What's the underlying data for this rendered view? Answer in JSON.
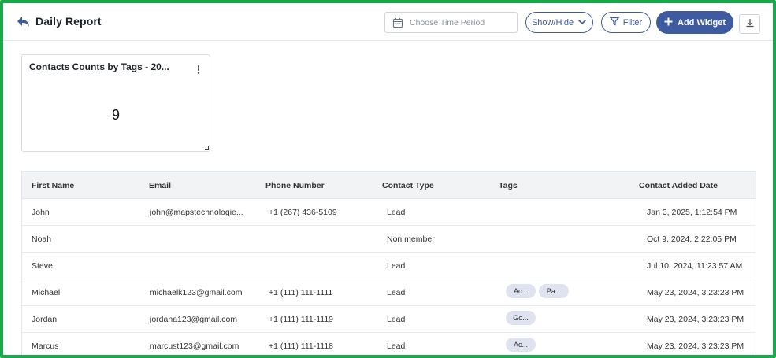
{
  "header": {
    "title": "Daily Report",
    "time_period_placeholder": "Choose Time Period",
    "show_hide_label": "Show/Hide",
    "filter_label": "Filter",
    "add_widget_label": "Add Widget"
  },
  "widget": {
    "title": "Contacts Counts by Tags - 20...",
    "count": "9"
  },
  "table": {
    "columns": [
      "First Name",
      "Email",
      "Phone Number",
      "Contact Type",
      "Tags",
      "Contact Added Date"
    ],
    "rows": [
      {
        "first_name": "John",
        "email": "john@mapstechnologie...",
        "phone": "+1 (267) 436-5109",
        "contact_type": "Lead",
        "tags": [
          "",
          ""
        ],
        "date": "Jan 3, 2025, 1:12:54 PM"
      },
      {
        "first_name": "Noah",
        "email": "",
        "phone": "",
        "contact_type": "Non member",
        "tags": [
          "",
          ""
        ],
        "date": "Oct 9, 2024, 2:22:05 PM"
      },
      {
        "first_name": "Steve",
        "email": "",
        "phone": "",
        "contact_type": "Lead",
        "tags": [
          "",
          ""
        ],
        "date": "Jul 10, 2024, 11:23:57 AM"
      },
      {
        "first_name": "Michael",
        "email": "michaelk123@gmail.com",
        "phone": "+1 (111) 111-1111",
        "contact_type": "Lead",
        "tags": [
          "Ac...",
          "Pa..."
        ],
        "date": "May 23, 2024, 3:23:23 PM"
      },
      {
        "first_name": "Jordan",
        "email": "jordana123@gmail.com",
        "phone": "+1 (111) 111-1119",
        "contact_type": "Lead",
        "tags": [
          "Go...",
          ""
        ],
        "date": "May 23, 2024, 3:23:23 PM"
      },
      {
        "first_name": "Marcus",
        "email": "marcust123@gmail.com",
        "phone": "+1 (111) 111-1118",
        "contact_type": "Lead",
        "tags": [
          "Ac...",
          ""
        ],
        "date": "May 23, 2024, 3:23:23 PM"
      }
    ]
  },
  "icons": {
    "back": "back-arrow-icon",
    "calendar": "calendar-icon",
    "chevron": "chevron-down-icon",
    "filter": "filter-icon",
    "add": "plus-icon",
    "download": "download-icon",
    "kebab": "more-vertical-icon"
  },
  "colors": {
    "frame_border": "#1aa64a",
    "brand": "#3f5b9f",
    "tag_bg": "#dfe3ef",
    "table_header_bg": "#f1f3f5"
  }
}
